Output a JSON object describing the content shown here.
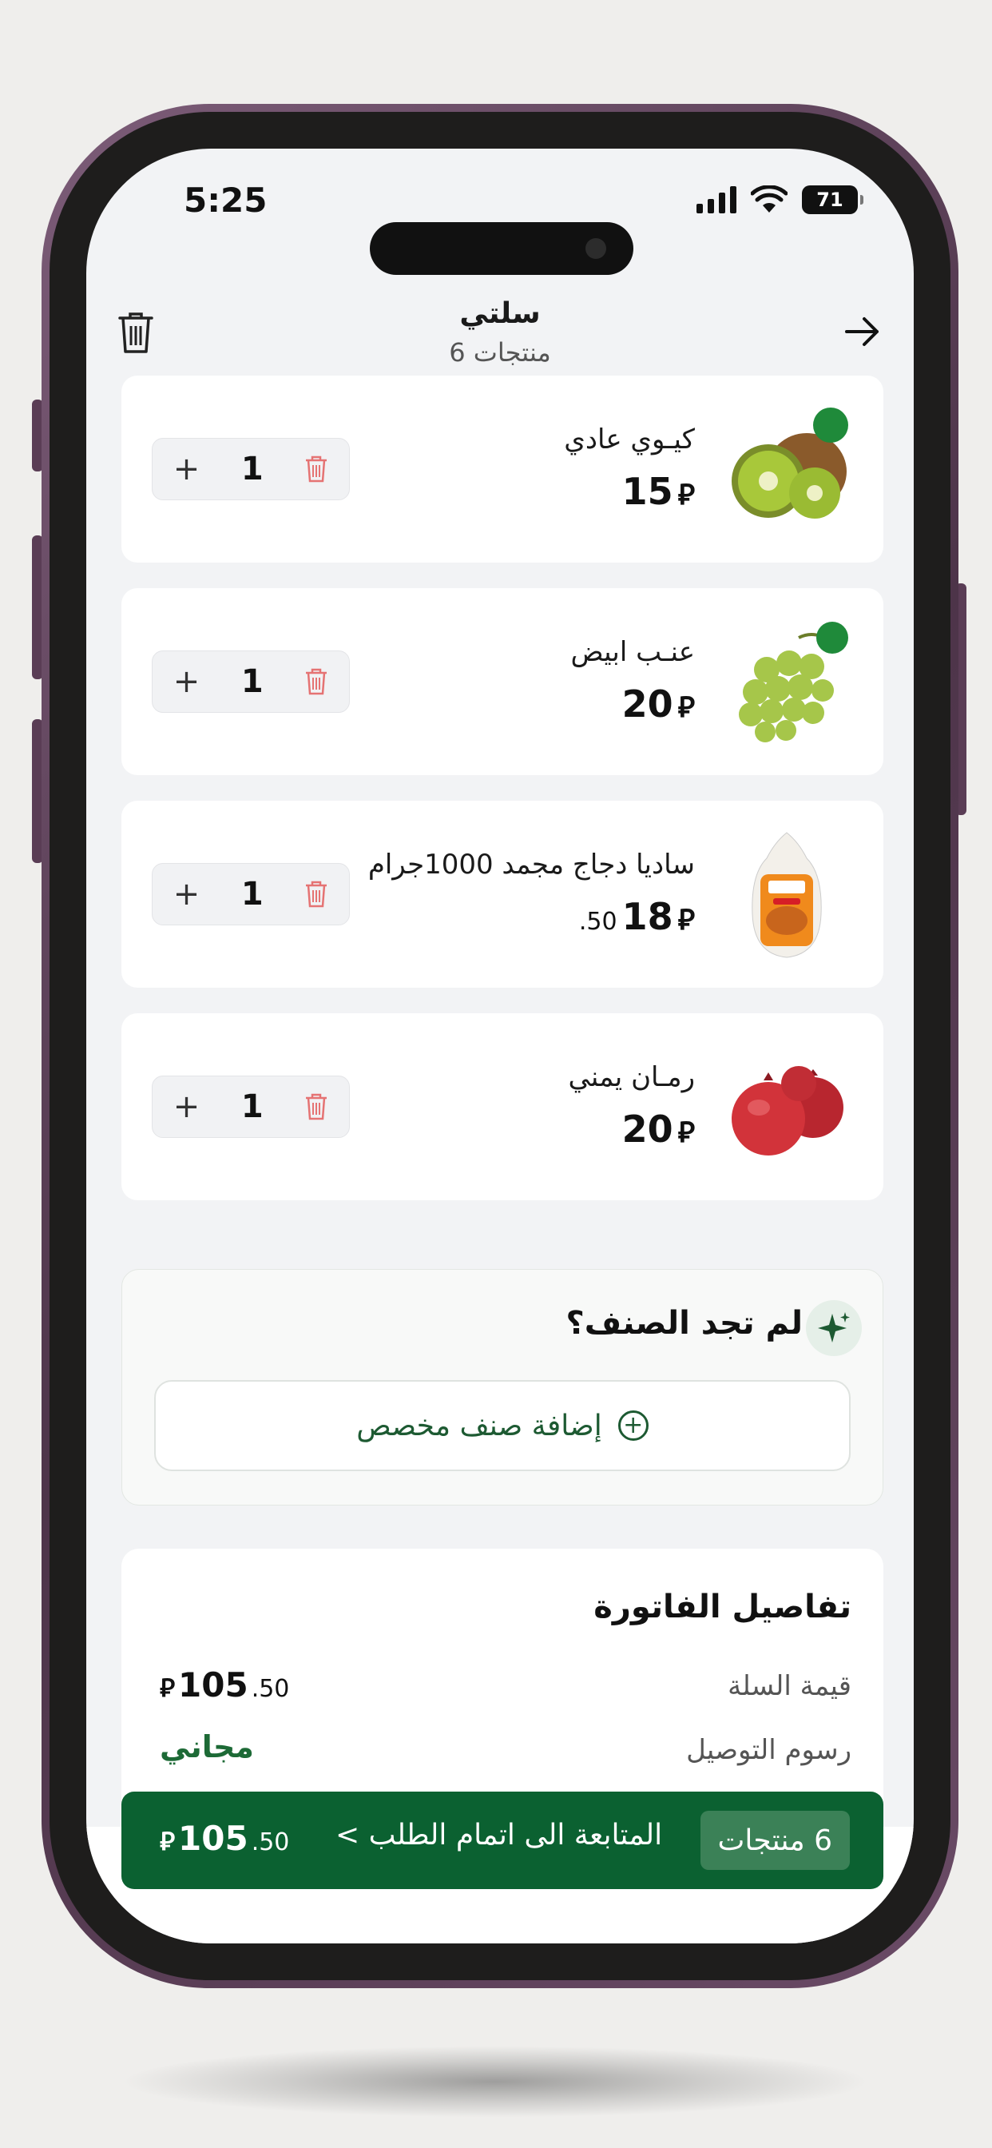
{
  "status": {
    "time": "5:25",
    "battery": "71"
  },
  "header": {
    "title": "سلتي",
    "subtitle": "6 منتجات"
  },
  "currency": "⃁",
  "products": [
    {
      "name": "كيـوي عادي",
      "price_int": "15",
      "price_dec": "",
      "qty": "1"
    },
    {
      "name": "عنـب ابيض",
      "price_int": "20",
      "price_dec": "",
      "qty": "1"
    },
    {
      "name": "ساديا دجاج مجمد 1000جرام",
      "price_int": "18",
      "price_dec": ".50",
      "qty": "1"
    },
    {
      "name": "رمـان يمني",
      "price_int": "20",
      "price_dec": "",
      "qty": "1"
    }
  ],
  "custom": {
    "title": "لم تجد الصنف؟",
    "button": "إضافة صنف مخصص"
  },
  "invoice": {
    "title": "تفاصيل الفاتورة",
    "basket_label": "قيمة السلة",
    "basket_int": "105",
    "basket_dec": ".50",
    "delivery_label": "رسوم التوصيل",
    "delivery_value": "مجاني"
  },
  "checkout": {
    "count": "6 منتجات",
    "cta": "المتابعة الى اتمام الطلب >",
    "total_int": "105",
    "total_dec": ".50"
  },
  "colors": {
    "brand_green": "#0b6131",
    "delete_red": "#e57373"
  }
}
